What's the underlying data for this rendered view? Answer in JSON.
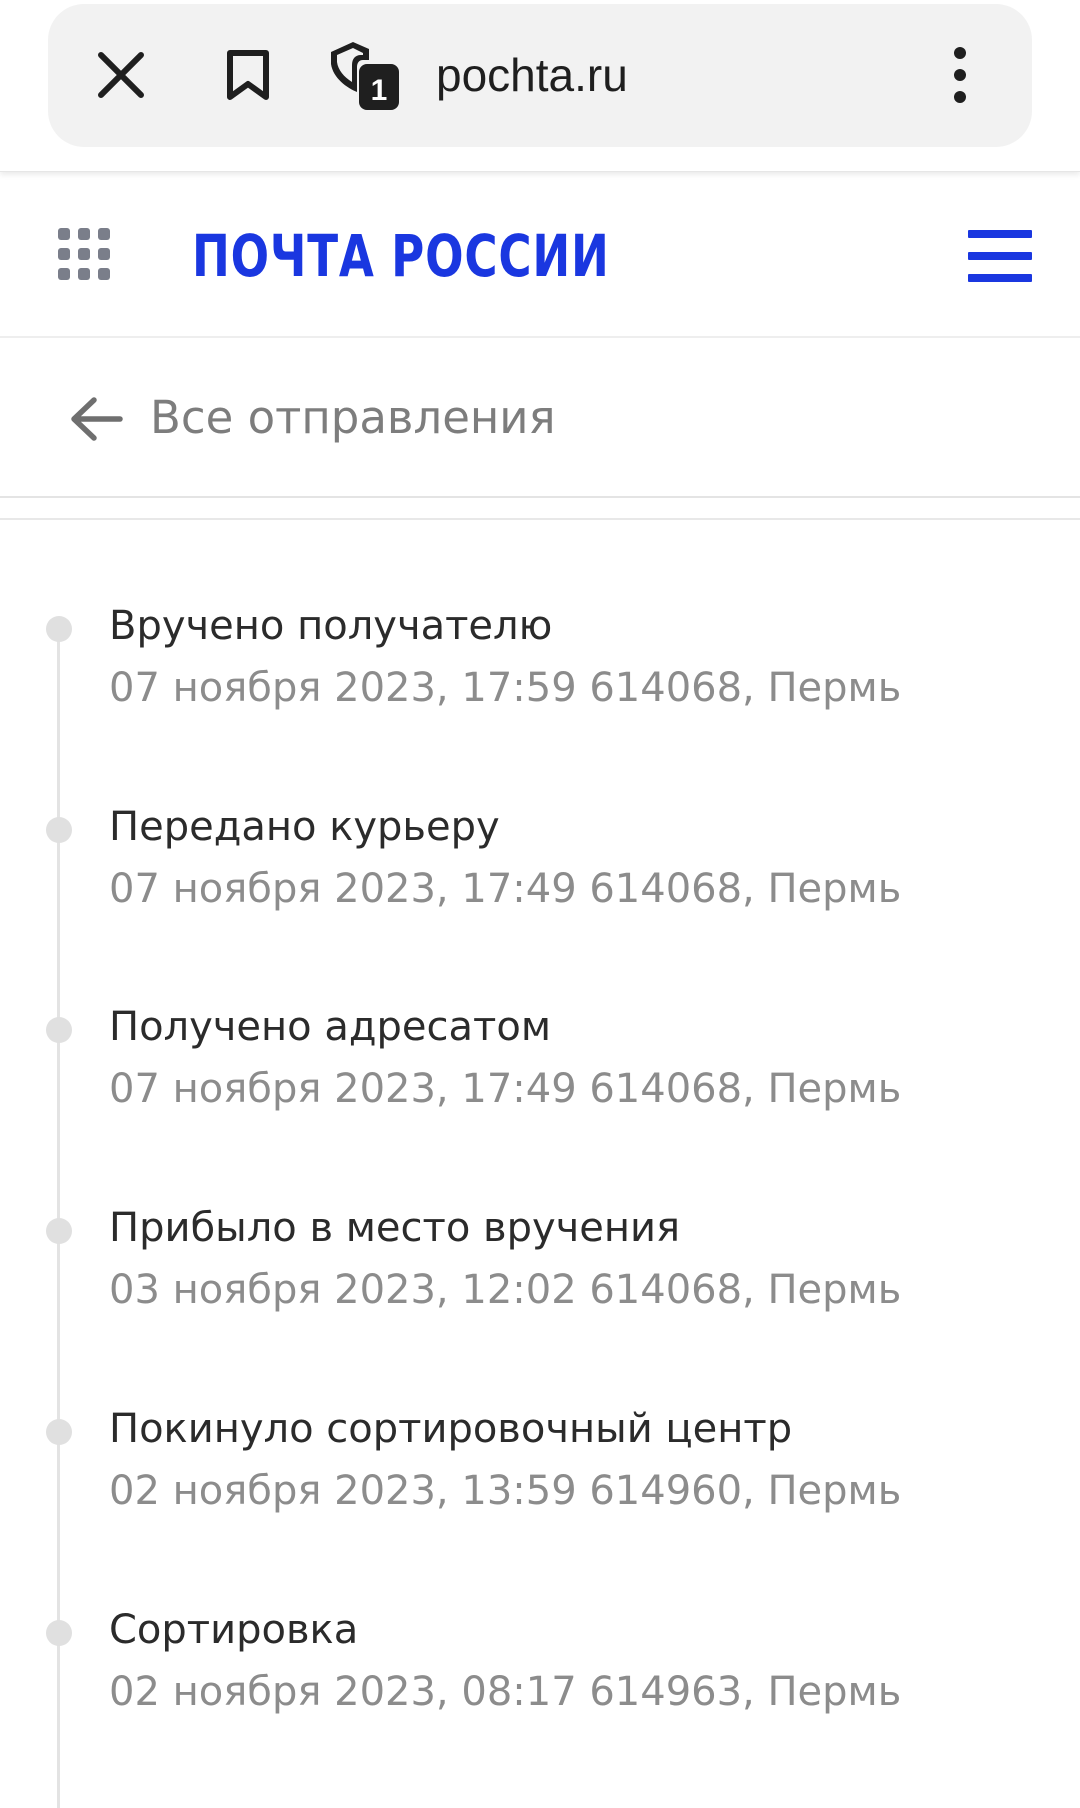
{
  "browser": {
    "url": "pochta.ru",
    "tab_count": "1",
    "icons": {
      "close": "close-icon",
      "bookmark": "bookmark-icon",
      "tabs": "shield-tab-icon",
      "menu": "more-vert-icon"
    }
  },
  "header": {
    "logo_text": "ПОЧТА РОССИИ",
    "brand_color": "#1a37e0",
    "icons": {
      "apps": "apps-grid-icon",
      "menu": "hamburger-menu-icon"
    }
  },
  "back": {
    "label": "Все отправления",
    "icon": "arrow-left-icon"
  },
  "timeline": {
    "events": [
      {
        "status": "Вручено получателю",
        "details": "07 ноября 2023, 17:59 614068, Пермь"
      },
      {
        "status": "Передано курьеру",
        "details": "07 ноября 2023, 17:49 614068, Пермь"
      },
      {
        "status": "Получено адресатом",
        "details": "07 ноября 2023, 17:49 614068, Пермь"
      },
      {
        "status": "Прибыло в место вручения",
        "details": "03 ноября 2023, 12:02 614068, Пермь"
      },
      {
        "status": "Покинуло сортировочный центр",
        "details": "02 ноября 2023, 13:59 614960, Пермь"
      },
      {
        "status": "Сортировка",
        "details": "02 ноября 2023, 08:17 614963, Пермь"
      }
    ]
  }
}
